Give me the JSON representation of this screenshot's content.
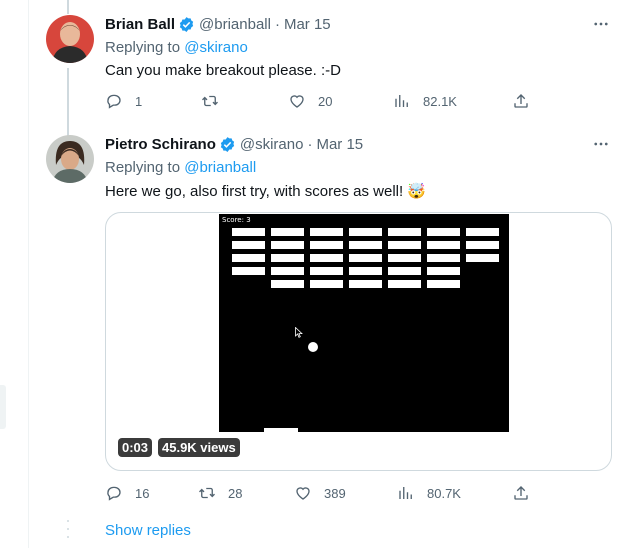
{
  "tweets": [
    {
      "name": "Brian Ball",
      "handle": "@brianball",
      "date": "Mar 15",
      "replying_label": "Replying to ",
      "replying_handle": "@skirano",
      "text": "Can you make breakout please. :-D",
      "replies": "1",
      "retweets": "",
      "likes": "20",
      "views": "82.1K"
    },
    {
      "name": "Pietro Schirano",
      "handle": "@skirano",
      "date": "Mar 15",
      "replying_label": "Replying to ",
      "replying_handle": "@brianball",
      "text": "Here we go, also first try, with scores as well! 🤯",
      "replies": "16",
      "retweets": "28",
      "likes": "389",
      "views": "80.7K",
      "video": {
        "game_score": "Score: 3",
        "duration": "0:03",
        "views_badge": "45.9K views",
        "brick_rows": [
          7,
          7,
          7,
          6,
          5
        ]
      }
    }
  ],
  "show_replies": "Show replies",
  "colors": {
    "accent": "#1d9bf0",
    "text": "#0f1419",
    "muted": "#536471",
    "border": "#cfd9de"
  },
  "icons": [
    "verified-badge-icon",
    "more-icon",
    "reply-icon",
    "retweet-icon",
    "like-icon",
    "views-icon",
    "share-icon"
  ]
}
